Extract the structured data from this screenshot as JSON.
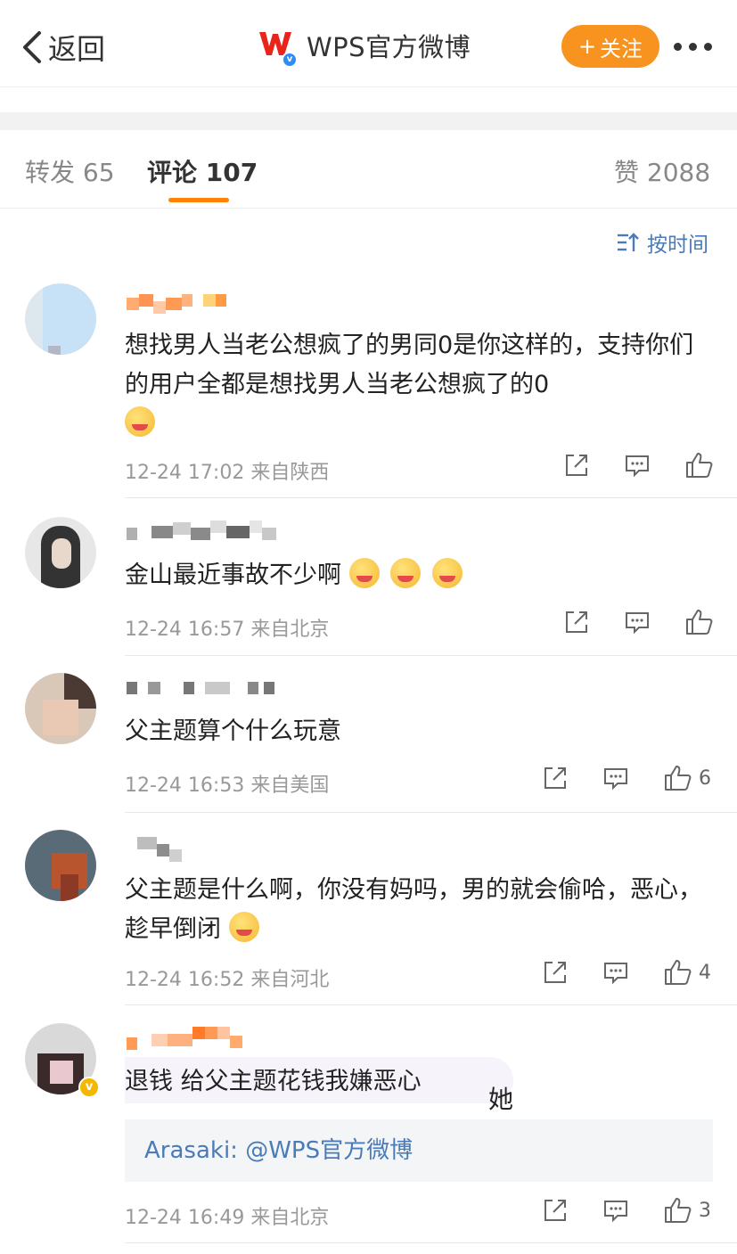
{
  "nav": {
    "back_label": "返回",
    "title": "WPS官方微博",
    "follow_label": "关注",
    "follow_plus": "+",
    "verified_mark": "v"
  },
  "tabs": {
    "repost": "转发 65",
    "comment": "评论 107",
    "like": "赞 2088"
  },
  "sort_label": "按时间",
  "colors": {
    "accent": "#ff8200",
    "follow_btn": "#f7931e",
    "link": "#4a7bb8"
  },
  "comments": [
    {
      "text": "想找男人当老公想疯了的男同0是你这样的，支持你们的用户全都是想找男人当老公想疯了的0",
      "time": "12-24 17:02",
      "location": "来自陕西",
      "likes": "",
      "emojis": 1
    },
    {
      "text": "金山最近事故不少啊",
      "time": "12-24 16:57",
      "location": "来自北京",
      "likes": "",
      "emojis": 3
    },
    {
      "text": "父主题算个什么玩意",
      "time": "12-24 16:53",
      "location": "来自美国",
      "likes": "6",
      "emojis": 0
    },
    {
      "text": "父主题是什么啊，你没有妈吗，男的就会偷哈，恶心，趁早倒闭",
      "time": "12-24 16:52",
      "location": "来自河北",
      "likes": "4",
      "emojis": 1
    },
    {
      "text": "退钱 给父主题花钱我嫌恶心",
      "time": "12-24 16:49",
      "location": "来自北京",
      "likes": "3",
      "quote": "Arasaki: @WPS官方微博",
      "vip_mark": "v",
      "sticker_char": "她"
    }
  ],
  "icons": [
    "chevron-left-icon",
    "wps-logo",
    "more-icon",
    "sort-icon",
    "share-icon",
    "comment-icon",
    "like-icon",
    "emoji-icon"
  ]
}
